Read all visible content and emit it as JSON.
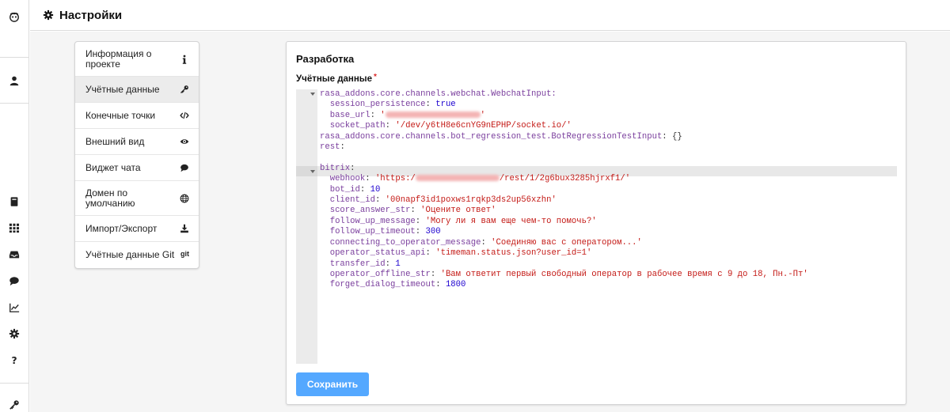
{
  "header": {
    "title": "Настройки"
  },
  "rail": {
    "icons": [
      "logo-owl-icon",
      "user-icon",
      "book-icon",
      "grid-icon",
      "inbox-icon",
      "chat-icon",
      "chart-icon",
      "gear-icon",
      "help-icon",
      "key-icon"
    ]
  },
  "menu": {
    "items": [
      {
        "label": "Информация о проекте",
        "icon": "info-icon"
      },
      {
        "label": "Учётные данные",
        "icon": "key-icon",
        "active": true
      },
      {
        "label": "Конечные точки",
        "icon": "code-icon"
      },
      {
        "label": "Внешний вид",
        "icon": "eye-icon"
      },
      {
        "label": "Виджет чата",
        "icon": "chat-icon"
      },
      {
        "label": "Домен по умолчанию",
        "icon": "globe-icon"
      },
      {
        "label": "Импорт/Экспорт",
        "icon": "download-icon"
      },
      {
        "label": "Учётные данные Git",
        "icon": "git-icon",
        "icon_text": "git"
      }
    ]
  },
  "card": {
    "title": "Разработка",
    "field_label": "Учётные данные",
    "required_mark": "*",
    "save_label": "Сохранить"
  },
  "code": {
    "l1": "rasa_addons.core.channels.webchat.WebchatInput:",
    "l2_key": "session_persistence",
    "l2_val": "true",
    "l3_key": "base_url",
    "l4_key": "socket_path",
    "l4_val": "'/dev/y6tH8e6cnYG9nEPHP/socket.io/'",
    "l5_key": "rasa_addons.core.channels.bot_regression_test.BotRegressionTestInput",
    "l5_val": "{}",
    "l6_key": "rest",
    "l8_key": "bitrix",
    "l9_key": "webhook",
    "l9_pre": "'https:/",
    "l9_post": "/rest/1/2g6bux3285hjrxf1/'",
    "l10_key": "bot_id",
    "l10_val": "10",
    "l11_key": "client_id",
    "l11_val": "'00napf3id1poxws1rqkp3ds2up56xzhn'",
    "l12_key": "score_answer_str",
    "l12_val": "'Оцените ответ'",
    "l13_key": "follow_up_message",
    "l13_val": "'Могу ли я вам еще чем-то помочь?'",
    "l14_key": "follow_up_timeout",
    "l14_val": "300",
    "l15_key": "connecting_to_operator_message",
    "l15_val": "'Соединяю вас с оператором...'",
    "l16_key": "operator_status_api",
    "l16_val": "'timeman.status.json?user_id=1'",
    "l17_key": "transfer_id",
    "l17_val": "1",
    "l18_key": "operator_offline_str",
    "l18_val": "'Вам ответит первый свободный оператор в рабочее время с 9 до 18, Пн.-Пт'",
    "l19_key": "forget_dialog_timeout",
    "l19_val": "1800"
  }
}
